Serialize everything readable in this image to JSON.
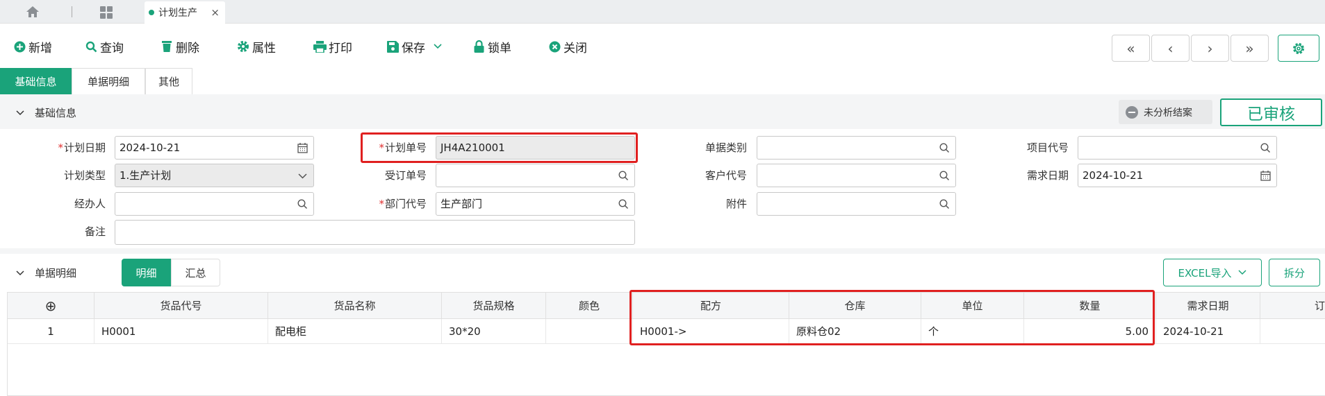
{
  "tabbar": {
    "doc_tab_label": "计划生产",
    "close_glyph": "×"
  },
  "toolbar": {
    "add": "新增",
    "query": "查询",
    "delete": "删除",
    "properties": "属性",
    "print": "打印",
    "save": "保存",
    "lock": "锁单",
    "close": "关闭",
    "nav": [
      "«",
      "‹",
      "›",
      "»"
    ]
  },
  "subtabs": [
    "基础信息",
    "单据明细",
    "其他"
  ],
  "basic_section": {
    "title": "基础信息",
    "unanalyzed": "未分析结案",
    "approved": "已审核"
  },
  "form": {
    "plan_date": {
      "label": "计划日期",
      "value": "2024-10-21",
      "required": "*"
    },
    "plan_no": {
      "label": "计划单号",
      "value": "JH4A210001",
      "required": "*"
    },
    "doc_type": {
      "label": "单据类别",
      "value": ""
    },
    "project_code": {
      "label": "项目代号",
      "value": ""
    },
    "plan_type": {
      "label": "计划类型",
      "value": "1.生产计划"
    },
    "order_no": {
      "label": "受订单号",
      "value": ""
    },
    "customer_code": {
      "label": "客户代号",
      "value": ""
    },
    "demand_date": {
      "label": "需求日期",
      "value": "2024-10-21"
    },
    "handler": {
      "label": "经办人",
      "value": ""
    },
    "dept_code": {
      "label": "部门代号",
      "value": "生产部门",
      "required": "*"
    },
    "attachment": {
      "label": "附件",
      "value": ""
    },
    "remark": {
      "label": "备注",
      "value": ""
    }
  },
  "detail_section": {
    "title": "单据明细",
    "seg_detail": "明细",
    "seg_summary": "汇总",
    "excel_import": "EXCEL导入",
    "split": "拆分"
  },
  "grid": {
    "add_glyph": "⊕",
    "columns": [
      "货品代号",
      "货品名称",
      "货品规格",
      "颜色",
      "配方",
      "仓库",
      "单位",
      "数量",
      "需求日期",
      "订"
    ],
    "rows": [
      {
        "no": "1",
        "code": "H0001",
        "name": "配电柜",
        "spec": "30*20",
        "color": "",
        "formula": "H0001->",
        "warehouse": "原料仓02",
        "unit": "个",
        "qty": "5.00",
        "demand_date": "2024-10-21"
      }
    ]
  },
  "colors": {
    "accent": "#1aa37a",
    "highlight": "#e02020"
  }
}
